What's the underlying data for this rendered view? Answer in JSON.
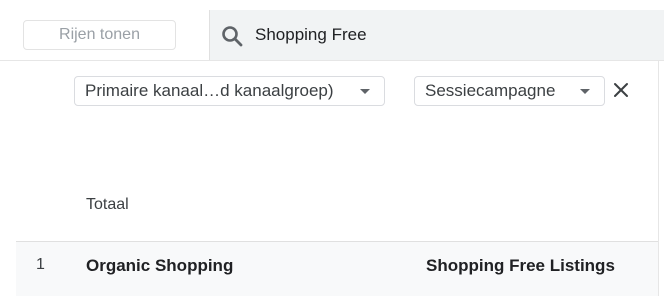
{
  "toolbar": {
    "rows_button_label": "Rijen tonen",
    "search_value": "Shopping Free"
  },
  "dimensions": {
    "primary_label": "Primaire kanaal…d kanaalgroep)",
    "secondary_label": "Sessiecampagne"
  },
  "table": {
    "total_label": "Totaal",
    "rows": [
      {
        "index": "1",
        "primary": "Organic Shopping",
        "secondary": "Shopping Free Listings"
      }
    ]
  },
  "icons": {
    "search": "search-icon",
    "dropdown": "chevron-down-icon",
    "close": "close-icon"
  },
  "colors": {
    "search_bg": "#f1f3f4",
    "row_bg": "#f8f9fa",
    "border": "#dadce0"
  }
}
